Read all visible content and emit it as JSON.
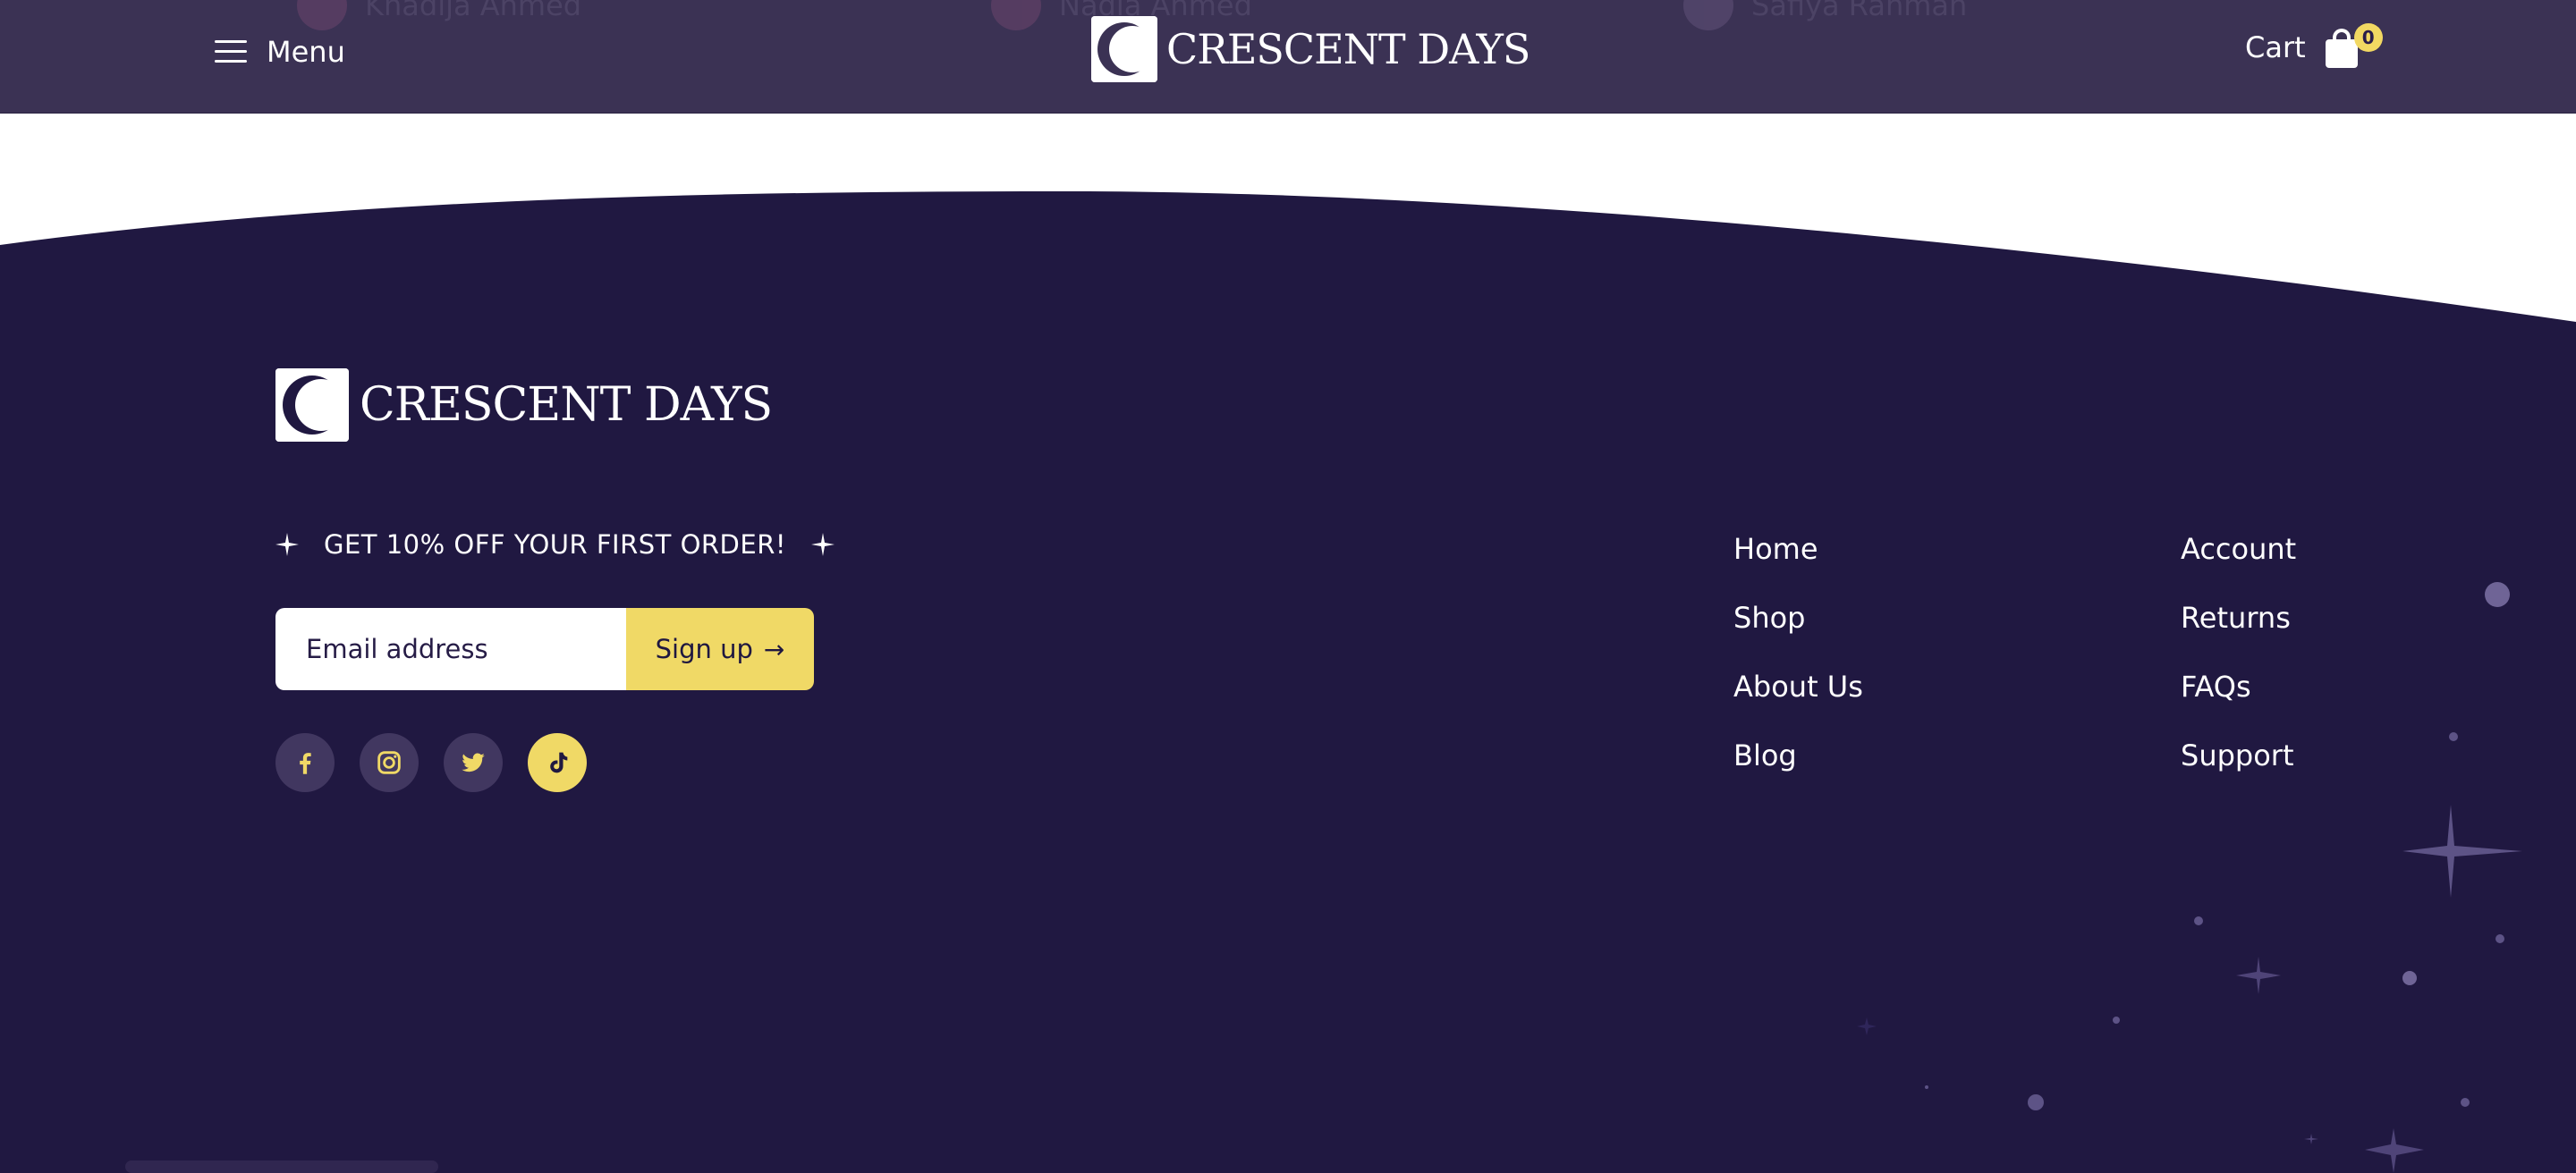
{
  "header": {
    "menu_label": "Menu",
    "brand": "CRESCENT DAYS",
    "cart_label": "Cart",
    "cart_count": "0",
    "scrolled_names": [
      "Khadija Ahmed",
      "Nadia Ahmed",
      "Safiya Rahman"
    ]
  },
  "footer": {
    "brand": "CRESCENT DAYS",
    "promo": "GET 10% OFF YOUR FIRST ORDER!",
    "email_placeholder": "Email address",
    "signup_label": "Sign up",
    "social": [
      {
        "name": "facebook",
        "icon": "facebook-icon"
      },
      {
        "name": "instagram",
        "icon": "instagram-icon"
      },
      {
        "name": "twitter",
        "icon": "twitter-icon"
      },
      {
        "name": "tiktok",
        "icon": "tiktok-icon",
        "active": true
      }
    ],
    "links_col1": [
      "Home",
      "Shop",
      "About Us",
      "Blog"
    ],
    "links_col2": [
      "Account",
      "Returns",
      "FAQs",
      "Support"
    ]
  },
  "colors": {
    "header_bg": "#3b3254",
    "footer_bg": "#201841",
    "accent_yellow": "#f0d966",
    "social_bg": "#413760",
    "star": "#6f6496"
  }
}
